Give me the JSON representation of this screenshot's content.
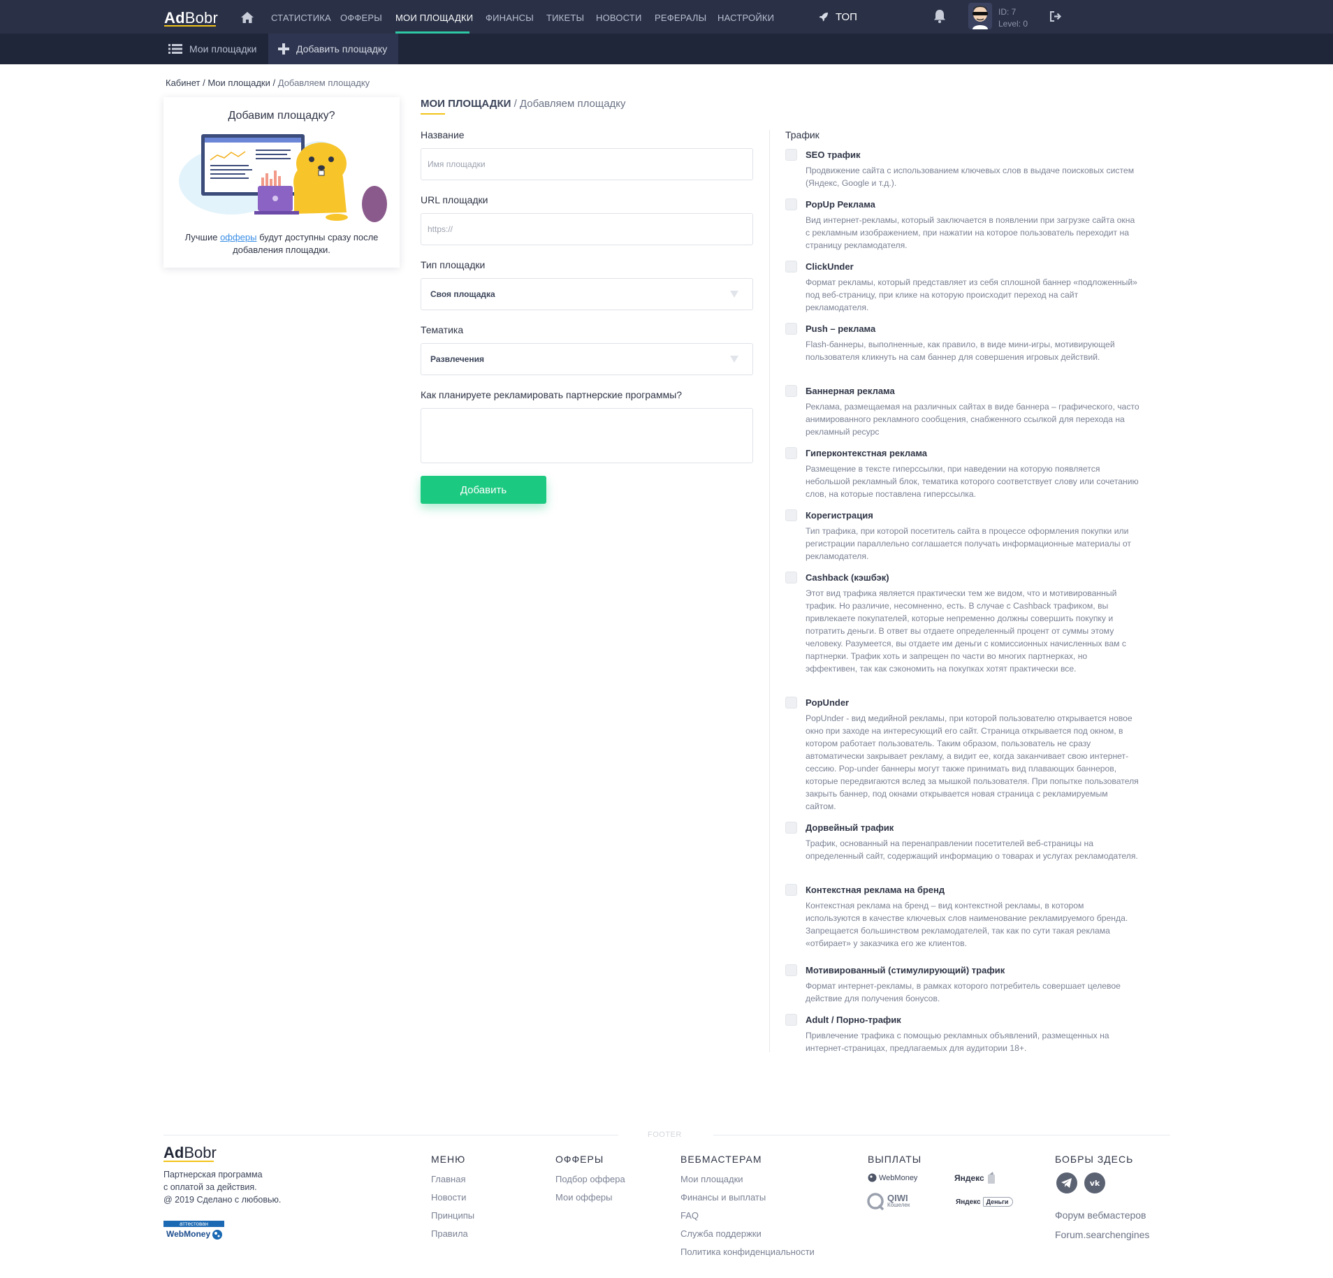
{
  "header": {
    "logo_bold": "Ad",
    "logo_light": "Bobr",
    "nav": [
      "СТАТИСТИКА",
      "ОФФЕРЫ",
      "МОИ ПЛОЩАДКИ",
      "ФИНАНСЫ",
      "ТИКЕТЫ",
      "НОВОСТИ",
      "РЕФЕРАЛЫ",
      "НАСТРОЙКИ"
    ],
    "active_nav": "МОИ ПЛОЩАДКИ",
    "top_label": "ТОП",
    "user_id": "ID: 7",
    "user_level": "Level: 0"
  },
  "subnav": {
    "my_sites": "Мои площадки",
    "add_site": "Добавить площадку"
  },
  "breadcrumb": {
    "home": "Кабинет",
    "sep": "/",
    "sites": "Мои площадки",
    "current": "Добавляем площадку"
  },
  "promo": {
    "title": "Добавим площадку?",
    "text_before": "Лучшие ",
    "link": "офферы",
    "text_after": " будут доступны сразу после добавления площадки."
  },
  "form": {
    "section_title": "МОИ ПЛОЩАДКИ",
    "section_subtitle": "/ Добавляем площадку",
    "name_label": "Название",
    "name_placeholder": "Имя площадки",
    "url_label": "URL площадки",
    "url_placeholder": "https://",
    "type_label": "Тип площадки",
    "type_value": "Своя площадка",
    "topic_label": "Тематика",
    "topic_value": "Развлечения",
    "plan_label": "Как планируете рекламировать партнерские программы?",
    "submit": "Добавить"
  },
  "traffic": {
    "title": "Трафик",
    "items": [
      {
        "name": "SEO трафик",
        "desc": "Продвижение сайта с использованием ключевых слов в выдаче поисковых систем (Яндекс, Google и т.д.)."
      },
      {
        "name": "PopUp Реклама",
        "desc": "Вид интернет-рекламы, который заключается в появлении при загрузке сайта окна с рекламным изображением, при нажатии на которое пользователь переходит на страницу рекламодателя."
      },
      {
        "name": "ClickUnder",
        "desc": "Формат рекламы, который представляет из себя сплошной баннер «подложенный» под веб-страницу, при клике на которую происходит переход на сайт рекламодателя."
      },
      {
        "name": "Push – реклама",
        "desc": "Flash-баннеры, выполненные, как правило, в виде мини-игры, мотивирующей пользователя кликнуть на сам баннер для совершения игровых действий."
      },
      {
        "name": "Баннерная реклама",
        "desc": "Реклама, размещаемая на различных сайтах в виде баннера – графического, часто анимированного рекламного сообщения, снабженного ссылкой для перехода на рекламный ресурс"
      },
      {
        "name": "Гиперконтекстная реклама",
        "desc": "Размещение в тексте гиперссылки, при наведении на которую появляется небольшой рекламный блок, тематика которого соответствует слову или сочетанию слов, на которые поставлена гиперссылка."
      },
      {
        "name": "Корегистрация",
        "desc": "Тип трафика, при которой посетитель сайта в процессе оформления покупки или регистрации параллельно соглашается получать информационные материалы от рекламодателя."
      },
      {
        "name": "Cashback (кэшбэк)",
        "desc": "Этот вид трафика является практически тем же видом, что и мотивированный трафик. Но различие, несомненно, есть. В случае с Cashback трафиком, вы привлекаете покупателей, которые непременно должны совершить покупку и потратить деньги. В ответ вы отдаете определенный процент от суммы этому человеку. Разумеется, вы отдаете им деньги с комиссионных начисленных вам с партнерки. Трафик хоть и запрещен по части во многих партнерках, но эффективен, так как сэкономить на покупках хотят практически все."
      },
      {
        "name": "PopUnder",
        "desc": "PopUnder - вид медийной рекламы, при которой пользователю открывается новое окно при заходе на интересующий его сайт. Страница открывается под окном, в котором работает пользователь. Таким образом, пользователь не сразу автоматически закрывает рекламу, а видит ее, когда заканчивает свою интернет-сессию. Pop-under баннеры могут также принимать вид плавающих баннеров, которые передвигаются вслед за мышкой пользователя. При попытке пользователя закрыть баннер, под окнами открывается новая страница с рекламируемым сайтом."
      },
      {
        "name": "Дорвейный трафик",
        "desc": "Трафик, основанный на перенаправлении посетителей веб-страницы на определенный сайт, содержащий информацию о товарах и услугах рекламодателя."
      },
      {
        "name": "Контекстная реклама на бренд",
        "desc": "Контекстная реклама на бренд – вид контекстной рекламы, в котором используются в качестве ключевых слов наименование рекламируемого бренда. Запрещается большинством рекламодателей, так как по сути такая реклама «отбирает» у заказчика его же клиентов."
      },
      {
        "name": "Мотивированный (стимулирующий) трафик",
        "desc": "Формат интернет-рекламы, в рамках которого потребитель совершает целевое действие для получения бонусов."
      },
      {
        "name": "Adult / Порно-трафик",
        "desc": "Привлечение трафика с помощью рекламных объявлений, размещенных на интернет-страницах, предлагаемых для аудитории 18+."
      }
    ]
  },
  "footer": {
    "tag": "FOOTER",
    "logo_bold": "Ad",
    "logo_light": "Bobr",
    "desc_1": "Партнерская программа",
    "desc_2": "с оплатой за действия.",
    "desc_3": "@ 2019 Сделано с любовью.",
    "wm_attest": "аттестован",
    "wm_name": "WebMoney",
    "menu_title": "МЕНЮ",
    "menu": [
      "Главная",
      "Новости",
      "Принципы",
      "Правила"
    ],
    "offers_title": "ОФФЕРЫ",
    "offers": [
      "Подбор оффера",
      "Мои офферы"
    ],
    "webmasters_title": "ВЕБМАСТЕРАМ",
    "webmasters": [
      "Мои площадки",
      "Финансы и выплаты",
      "FAQ",
      "Служба поддержки",
      "Политика конфиденциальности"
    ],
    "payouts_title": "ВЫПЛАТЫ",
    "pay_webmoney": "WebMoney",
    "pay_yandex": "Яндекс",
    "pay_qiwi": "QIWI",
    "pay_qiwi_sub": "Кошелек",
    "pay_yandex_money": "Яндекс",
    "pay_yandex_money_box": "Деньги",
    "beavers_title": "БОБРЫ ЗДЕСЬ",
    "forum_1": "Форум вебмастеров",
    "forum_2": "Forum.searchengines"
  }
}
